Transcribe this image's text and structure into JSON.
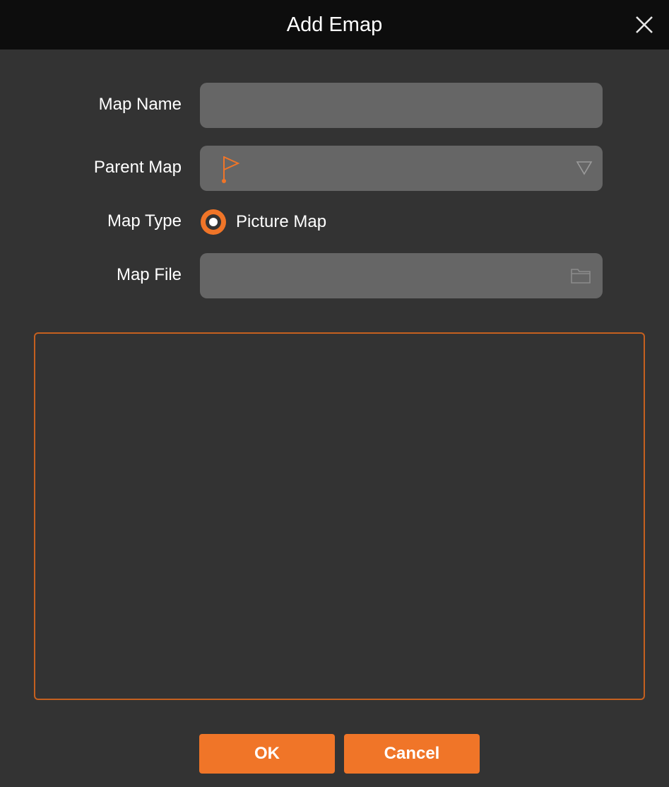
{
  "dialog": {
    "title": "Add Emap"
  },
  "form": {
    "map_name": {
      "label": "Map Name",
      "value": ""
    },
    "parent_map": {
      "label": "Parent Map",
      "value": ""
    },
    "map_type": {
      "label": "Map Type",
      "option_label": "Picture Map",
      "selected": true
    },
    "map_file": {
      "label": "Map File",
      "value": ""
    }
  },
  "buttons": {
    "ok_label": "OK",
    "cancel_label": "Cancel"
  },
  "icons": {
    "close": "close-icon",
    "flag": "flag-icon",
    "dropdown": "chevron-down-icon",
    "folder": "folder-icon"
  },
  "colors": {
    "accent": "#f07528",
    "background": "#333333",
    "titlebar": "#0d0d0d",
    "field": "#666666",
    "preview_border": "#c5601f"
  }
}
